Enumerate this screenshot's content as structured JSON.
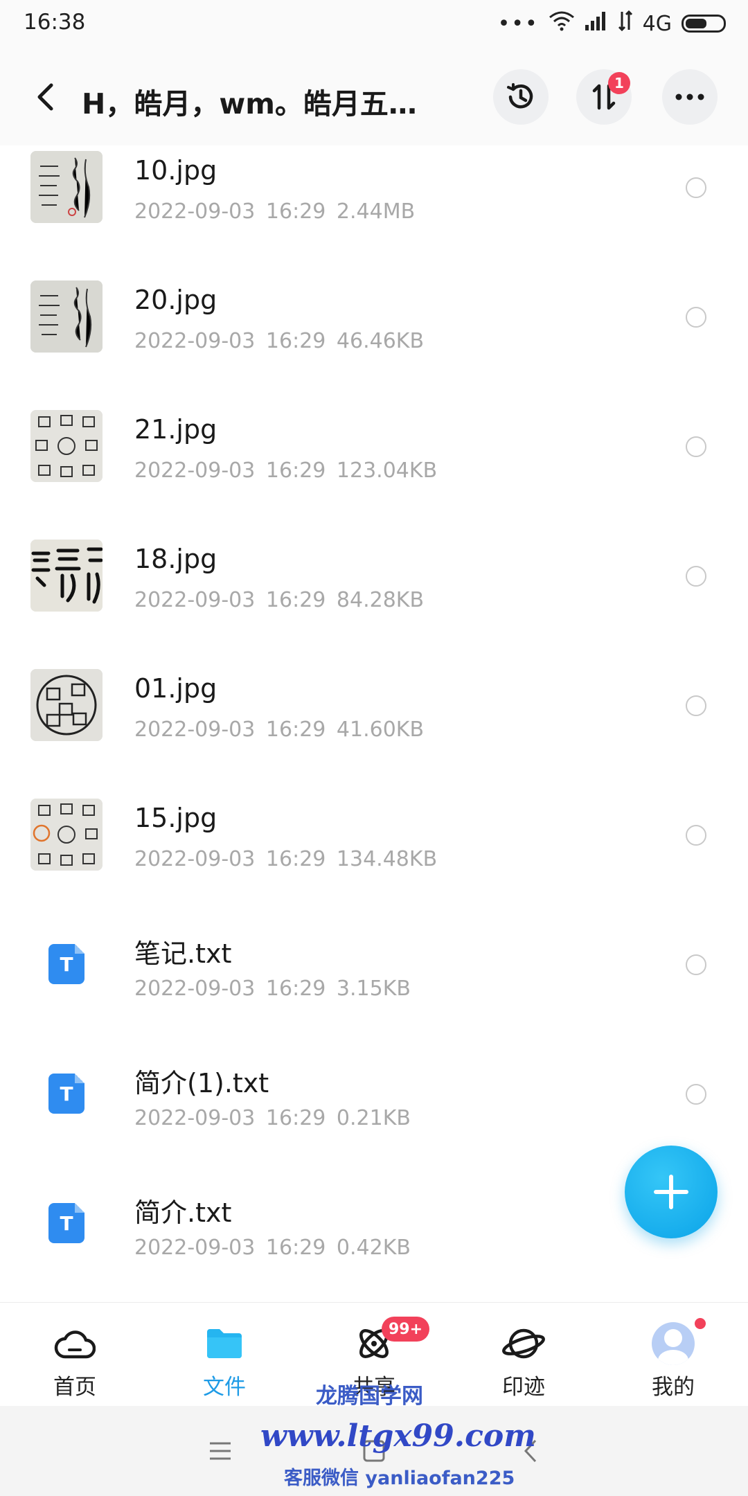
{
  "status_bar": {
    "time": "16:38",
    "signal_text": "4G",
    "icons": [
      "more-dots-icon",
      "wifi-icon",
      "signal-icon",
      "data-arrows-icon",
      "battery-icon"
    ]
  },
  "header": {
    "title": "H，皓月，wm。皓月五雷...",
    "transfer_badge": "1",
    "icons": [
      "back-arrow-icon",
      "history-icon",
      "transfer-icon",
      "more-icon"
    ]
  },
  "files": [
    {
      "name": "10.jpg",
      "date": "2022-09-03",
      "time": "16:29",
      "size": "2.44MB",
      "kind": "image"
    },
    {
      "name": "20.jpg",
      "date": "2022-09-03",
      "time": "16:29",
      "size": "46.46KB",
      "kind": "image"
    },
    {
      "name": "21.jpg",
      "date": "2022-09-03",
      "time": "16:29",
      "size": "123.04KB",
      "kind": "image"
    },
    {
      "name": "18.jpg",
      "date": "2022-09-03",
      "time": "16:29",
      "size": "84.28KB",
      "kind": "image"
    },
    {
      "name": "01.jpg",
      "date": "2022-09-03",
      "time": "16:29",
      "size": "41.60KB",
      "kind": "image"
    },
    {
      "name": "15.jpg",
      "date": "2022-09-03",
      "time": "16:29",
      "size": "134.48KB",
      "kind": "image"
    },
    {
      "name": "笔记.txt",
      "date": "2022-09-03",
      "time": "16:29",
      "size": "3.15KB",
      "kind": "text"
    },
    {
      "name": "简介(1).txt",
      "date": "2022-09-03",
      "time": "16:29",
      "size": "0.21KB",
      "kind": "text"
    },
    {
      "name": "简介.txt",
      "date": "2022-09-03",
      "time": "16:29",
      "size": "0.42KB",
      "kind": "text"
    }
  ],
  "txt_icon_letter": "T",
  "tabs": [
    {
      "label": "首页",
      "icon": "cloud-icon",
      "active": false
    },
    {
      "label": "文件",
      "icon": "folder-icon",
      "active": true
    },
    {
      "label": "共享",
      "icon": "atom-share-icon",
      "active": false,
      "badge": "99+"
    },
    {
      "label": "印迹",
      "icon": "planet-icon",
      "active": false
    },
    {
      "label": "我的",
      "icon": "avatar-icon",
      "active": false,
      "dot": true
    }
  ],
  "watermark": {
    "line1": "龙腾国学网",
    "line2": "www.ltgx99.com",
    "line3": "客服微信 yanliaofan225"
  },
  "colors": {
    "accent": "#1e9be6",
    "badge": "#f2415a",
    "fab": "#0aa3e8",
    "txt_icon": "#2f8cf0",
    "watermark": "#3148c6"
  }
}
